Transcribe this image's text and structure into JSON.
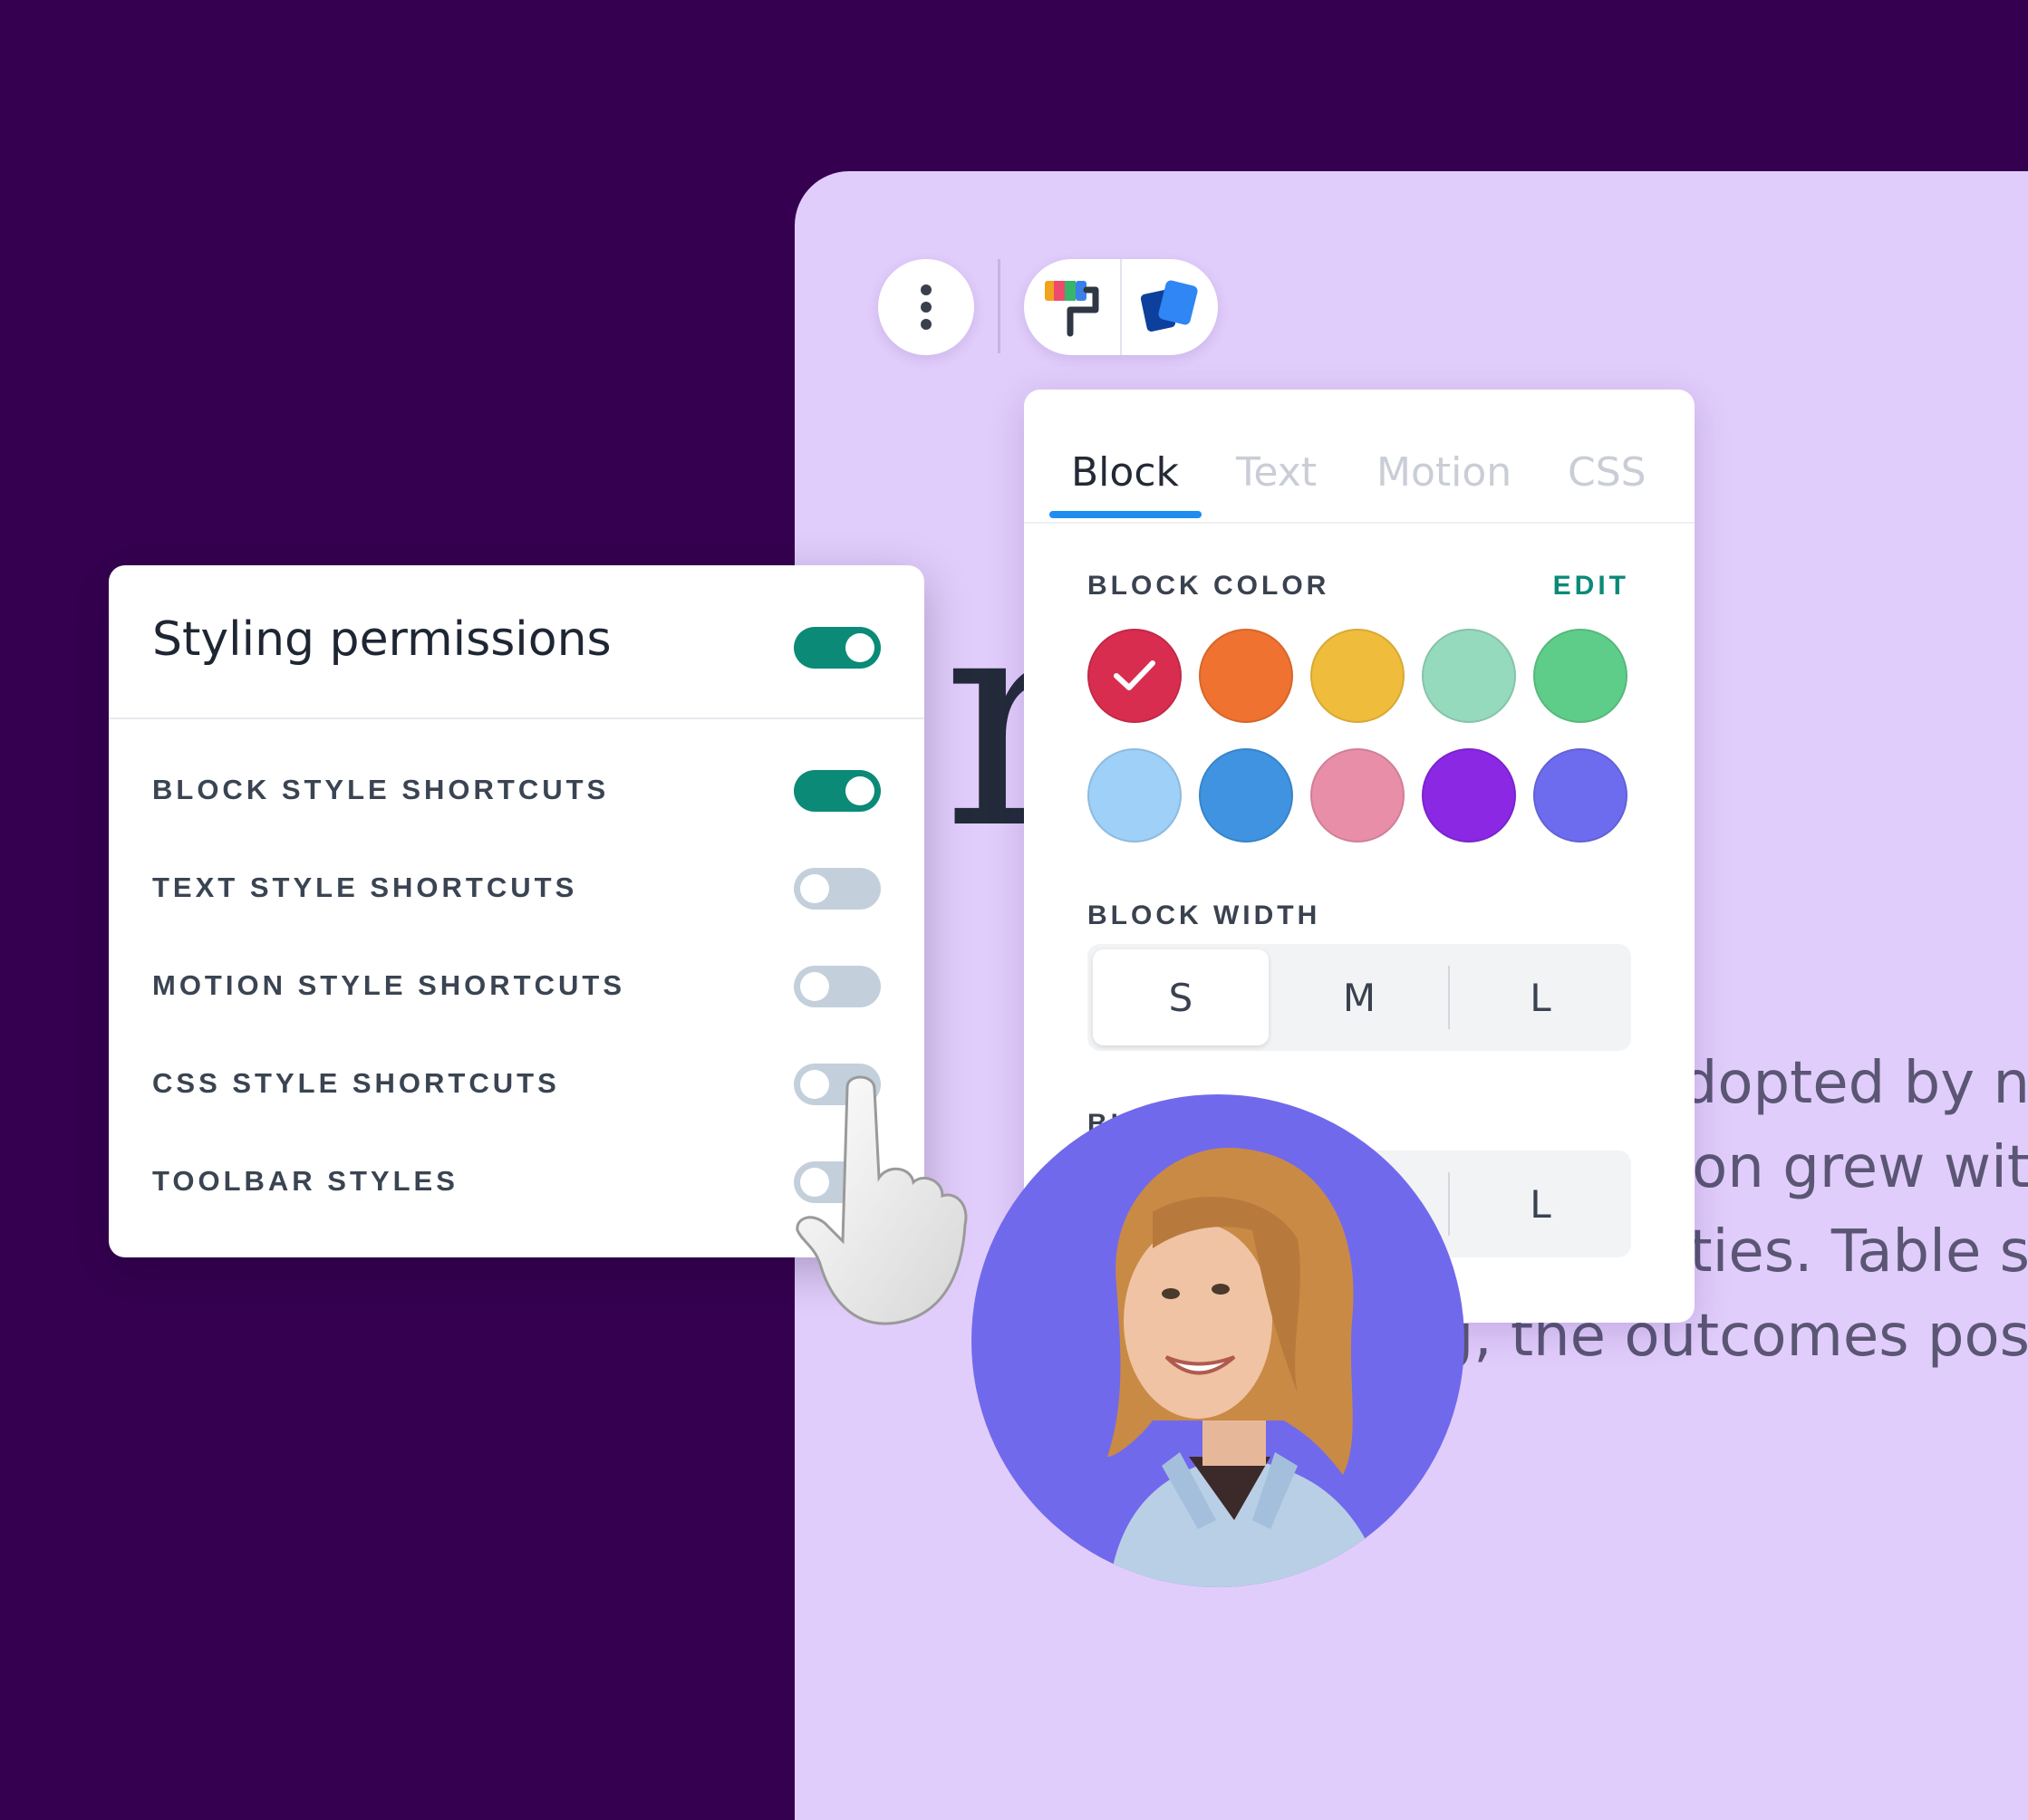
{
  "heading_fragment": "rvic",
  "body_lines": [
    "adopted by n",
    "tion grew wit",
    "ilities. Table s",
    "ing, the outcomes pos"
  ],
  "toolbar": {
    "more_icon": "vertical-dots-icon",
    "tools": [
      {
        "icon": "paint-roller-icon"
      },
      {
        "icon": "layered-cards-icon"
      }
    ]
  },
  "style_panel": {
    "tabs": [
      {
        "label": "Block",
        "active": true
      },
      {
        "label": "Text",
        "active": false
      },
      {
        "label": "Motion",
        "active": false
      },
      {
        "label": "CSS",
        "active": false
      }
    ],
    "block_color": {
      "label": "BLOCK COLOR",
      "edit_label": "EDIT",
      "selected_index": 0,
      "swatches": [
        "#d92d50",
        "#ef7230",
        "#f0bc3c",
        "#96dabd",
        "#5fcd8a",
        "#9ed0f8",
        "#3f93e0",
        "#e88ea8",
        "#8a28e4",
        "#6e6cee"
      ]
    },
    "block_width": {
      "label": "BLOCK WIDTH",
      "options": [
        "S",
        "M",
        "L"
      ],
      "selected": "S"
    },
    "block_spacing": {
      "label_visible_start": "BL",
      "label_visible_end": "G",
      "options_visible": [
        "L"
      ]
    }
  },
  "permissions": {
    "title": "Styling permissions",
    "enabled": true,
    "rows": [
      {
        "label": "BLOCK STYLE SHORTCUTS",
        "on": true
      },
      {
        "label": "TEXT STYLE SHORTCUTS",
        "on": false
      },
      {
        "label": "MOTION STYLE SHORTCUTS",
        "on": false
      },
      {
        "label": "CSS STYLE SHORTCUTS",
        "on": false
      },
      {
        "label": "TOOLBAR STYLES",
        "on": false
      }
    ]
  },
  "colors": {
    "background": "#350050",
    "canvas": "#e1cdfb",
    "accent_green": "#0b8a78",
    "tab_indicator": "#1f8df0",
    "avatar_bg": "#7169ec"
  }
}
